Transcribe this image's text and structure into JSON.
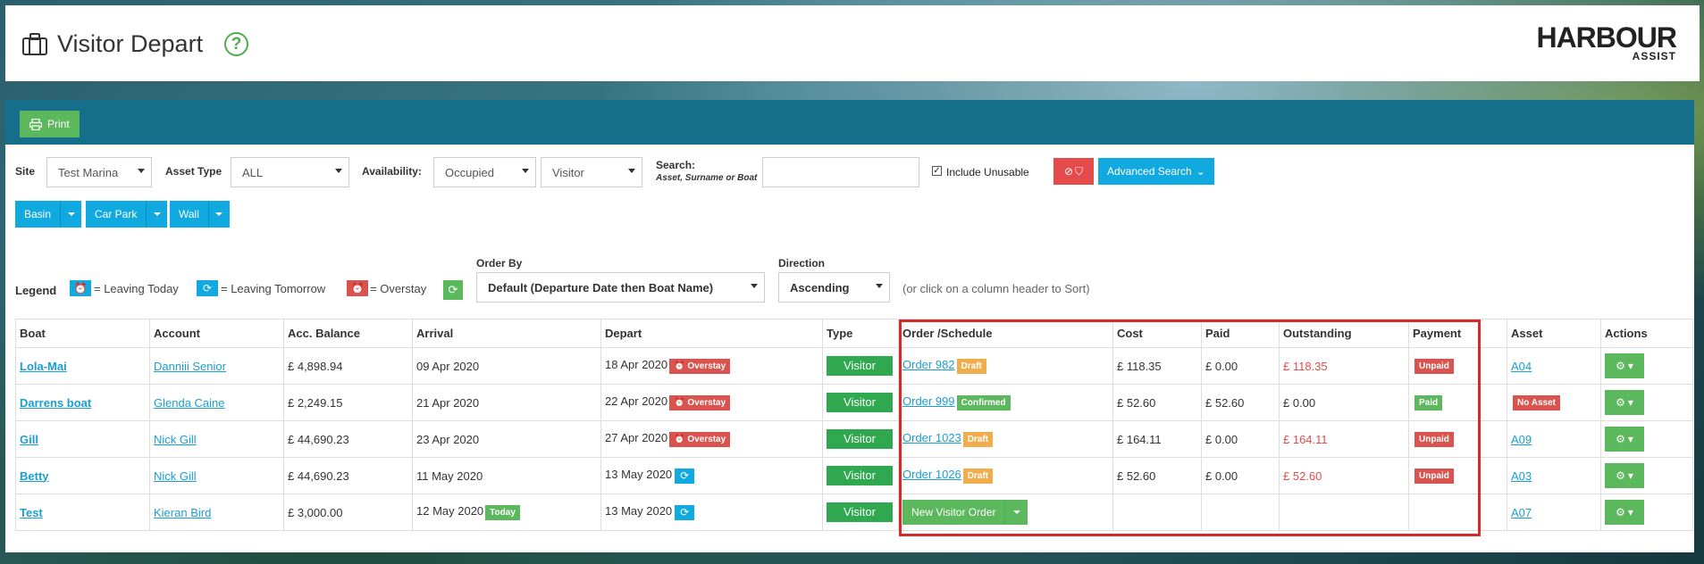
{
  "header": {
    "title": "Visitor Depart",
    "help_glyph": "?",
    "logo_main": "HARBOUR",
    "logo_sub": "ASSIST"
  },
  "toolbar": {
    "print_label": "Print"
  },
  "filters": {
    "site_label": "Site",
    "site_value": "Test Marina",
    "asset_type_label": "Asset Type",
    "asset_type_value": "ALL",
    "availability_label": "Availability:",
    "availability_value": "Occupied",
    "availability_type_value": "Visitor",
    "search_label": "Search:",
    "search_sublabel": "Asset, Surname or Boat",
    "search_value": "",
    "include_unusable_label": "Include Unusable",
    "include_unusable_checked": true,
    "advanced_search_label": "Advanced Search"
  },
  "area_buttons": [
    {
      "label": "Basin"
    },
    {
      "label": "Car Park"
    },
    {
      "label": "Wall"
    }
  ],
  "legend": {
    "title": "Legend",
    "items": [
      {
        "text": "= Leaving Today",
        "color": "#10a9e0",
        "icon": "alarm-icon"
      },
      {
        "text": "= Leaving Tomorrow",
        "color": "#10a9e0",
        "icon": "refresh-icon"
      },
      {
        "text": "= Overstay",
        "color": "#d9534f",
        "icon": "alarm-clock-icon"
      }
    ]
  },
  "order_by": {
    "label": "Order By",
    "value": "Default (Departure Date then Boat Name)"
  },
  "direction": {
    "label": "Direction",
    "value": "Ascending"
  },
  "sort_hint": "(or click on a column header to Sort)",
  "table": {
    "columns": [
      "Boat",
      "Account",
      "Acc. Balance",
      "Arrival",
      "Depart",
      "Type",
      "Order /Schedule",
      "Cost",
      "Paid",
      "Outstanding",
      "Payment",
      "Asset",
      "Actions"
    ],
    "rows": [
      {
        "boat": "Lola-Mai",
        "account": "Danniii Senior",
        "balance": "£ 4,898.94",
        "arrival": "09 Apr 2020",
        "arrival_badge": "",
        "depart": "18 Apr 2020",
        "depart_badge": "Overstay",
        "type": "Visitor",
        "order": "Order 982",
        "order_status": "Draft",
        "cost": "£ 118.35",
        "paid": "£ 0.00",
        "outstanding": "£ 118.35",
        "payment": "Unpaid",
        "asset": "A04"
      },
      {
        "boat": "Darrens boat",
        "account": "Glenda Caine",
        "balance": "£ 2,249.15",
        "arrival": "21 Apr 2020",
        "arrival_badge": "",
        "depart": "22 Apr 2020",
        "depart_badge": "Overstay",
        "type": "Visitor",
        "order": "Order 999",
        "order_status": "Confirmed",
        "cost": "£ 52.60",
        "paid": "£ 52.60",
        "outstanding": "£ 0.00",
        "payment": "Paid",
        "asset": "No Asset"
      },
      {
        "boat": "Gill",
        "account": "Nick Gill",
        "balance": "£ 44,690.23",
        "arrival": "23 Apr 2020",
        "arrival_badge": "",
        "depart": "27 Apr 2020",
        "depart_badge": "Overstay",
        "type": "Visitor",
        "order": "Order 1023",
        "order_status": "Draft",
        "cost": "£ 164.11",
        "paid": "£ 0.00",
        "outstanding": "£ 164.11",
        "payment": "Unpaid",
        "asset": "A09"
      },
      {
        "boat": "Betty",
        "account": "Nick Gill",
        "balance": "£ 44,690.23",
        "arrival": "11 May 2020",
        "arrival_badge": "",
        "depart": "13 May 2020",
        "depart_badge": "tomorrow",
        "type": "Visitor",
        "order": "Order 1026",
        "order_status": "Draft",
        "cost": "£ 52.60",
        "paid": "£ 0.00",
        "outstanding": "£ 52.60",
        "payment": "Unpaid",
        "asset": "A03"
      },
      {
        "boat": "Test",
        "account": "Kieran Bird",
        "balance": "£ 3,000.00",
        "arrival": "12 May 2020",
        "arrival_badge": "Today",
        "depart": "13 May 2020",
        "depart_badge": "tomorrow",
        "type": "Visitor",
        "new_order_label": "New Visitor Order",
        "asset": "A07"
      }
    ]
  }
}
